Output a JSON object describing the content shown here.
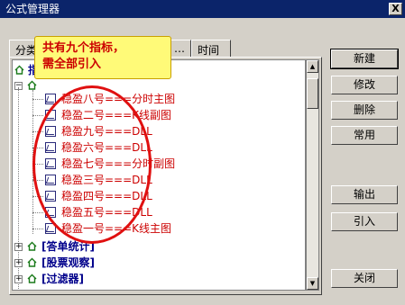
{
  "window": {
    "title": "公式管理器",
    "close_glyph": "X"
  },
  "tabs": [
    {
      "label": "分类"
    },
    {
      "label": "…"
    },
    {
      "label": "时间"
    }
  ],
  "callout": {
    "line1": "共有九个指标，",
    "line2": "需全部引入"
  },
  "tree": {
    "root_label": "指",
    "items": [
      {
        "label": "稳盈八号===分时主图"
      },
      {
        "label": "稳盈二号===K线副图"
      },
      {
        "label": "稳盈九号===DLL"
      },
      {
        "label": "稳盈六号===DLL"
      },
      {
        "label": "稳盈七号===分时副图"
      },
      {
        "label": "稳盈三号===DLL"
      },
      {
        "label": "稳盈四号===DLL"
      },
      {
        "label": "稳盈五号===DLL"
      },
      {
        "label": "稳盈一号===K线主图"
      }
    ],
    "groups": [
      {
        "label": "[答单统计]"
      },
      {
        "label": "[股票观察]"
      },
      {
        "label": "[过滤器]"
      }
    ]
  },
  "buttons": {
    "new": "新建",
    "modify": "修改",
    "delete": "删除",
    "common": "常用",
    "export": "输出",
    "import": "引入",
    "close": "关闭"
  },
  "colors": {
    "title_bar": "#0b246a",
    "item_text": "#cc0000",
    "group_text": "#00008b",
    "callout_bg": "#fffa78",
    "ellipse": "#e01010"
  }
}
